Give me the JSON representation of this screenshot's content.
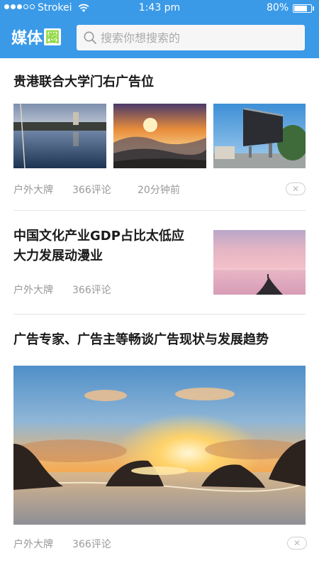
{
  "status_bar": {
    "carrier": "Strokei",
    "time": "1:43 pm",
    "battery_percent": "80%",
    "battery_level": 0.8
  },
  "header": {
    "logo_text": "媒体",
    "logo_box_text": "圈",
    "search_placeholder": "搜索你想搜索的"
  },
  "articles": [
    {
      "title": "贵港联合大学门右广告位",
      "source": "户外大牌",
      "comments": "366评论",
      "time": "20分钟前",
      "close": "✕"
    },
    {
      "title_line1": "中国文化产业GDP占比太低应",
      "title_line2": "大力发展动漫业",
      "source": "户外大牌",
      "comments": "366评论"
    },
    {
      "title": "广告专家、广告主等畅谈广告现状与发展趋势",
      "source": "户外大牌",
      "comments": "366评论",
      "close": "✕"
    }
  ],
  "colors": {
    "header_bg": "#3a9ae8",
    "logo_accent": "#8bd63a",
    "meta_text": "#999999"
  }
}
